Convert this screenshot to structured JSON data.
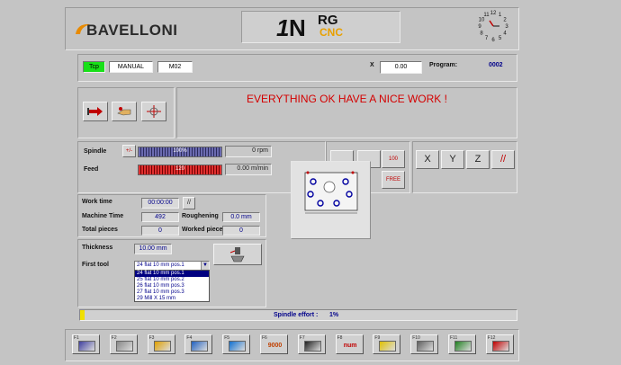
{
  "header": {
    "brand": "BAVELLONI",
    "product_top": "RG",
    "product_bottom": "CNC",
    "product_digit": "1",
    "product_n": "N",
    "clock_numbers": [
      "12",
      "1",
      "2",
      "3",
      "4",
      "5",
      "6",
      "7",
      "8",
      "9",
      "10",
      "11"
    ]
  },
  "mode": {
    "status": "Tcp",
    "mode": "MANUAL",
    "code": "M02"
  },
  "axis": {
    "label": "X",
    "value": "0.00"
  },
  "program": {
    "label": "Program:",
    "value": "0002"
  },
  "message": "EVERYTHING OK HAVE A NICE WORK !",
  "spindle": {
    "label": "Spindle",
    "percent_text": "100%",
    "percent": 1.0,
    "rpm": "0 rpm",
    "toggle": "+/-"
  },
  "feed": {
    "label": "Feed",
    "value_text": "120",
    "percent": 1.0,
    "speed": "0.00 m/min"
  },
  "jog": {
    "buttons": [
      "X",
      "Y",
      "Z",
      "//"
    ],
    "speed_buttons": [
      "100",
      "FREE"
    ]
  },
  "stats": {
    "work_time_label": "Work time",
    "work_time": "00:00:00",
    "machine_time_label": "Machine Time",
    "machine_time": "492",
    "roughening_label": "Roughening",
    "roughening": "0.0 mm",
    "total_pieces_label": "Total pieces",
    "total_pieces": "0",
    "worked_pieces_label": "Worked pieces",
    "worked_pieces": "0",
    "reset_label": "//"
  },
  "tool": {
    "thickness_label": "Thickness",
    "thickness": "10.00 mm",
    "first_tool_label": "First tool",
    "selected": "24 flat 10 mm pos.1",
    "options": [
      "24 flat 10 mm pos.1",
      "25 flat 10 mm pos.2",
      "26 flat 10 mm pos.3",
      "27 flat 10 mm pos.3",
      "29 Mill X 15 mm"
    ]
  },
  "effort": {
    "label": "Spindle effort :",
    "value": "1%",
    "percent": 0.01
  },
  "fkeys": [
    {
      "num": "F1",
      "icon": "camera-icon"
    },
    {
      "num": "F2",
      "icon": "document-icon"
    },
    {
      "num": "F3",
      "icon": "open-folder-icon"
    },
    {
      "num": "F4",
      "icon": "image-icon"
    },
    {
      "num": "F5",
      "icon": "axes-icon"
    },
    {
      "num": "F6",
      "icon": "counter-9000-icon",
      "text": "9000"
    },
    {
      "num": "F7",
      "icon": "monitor-icon"
    },
    {
      "num": "F8",
      "icon": "num-logo-icon",
      "text": "num"
    },
    {
      "num": "F9",
      "icon": "warning-icon"
    },
    {
      "num": "F10",
      "icon": "tool-icon"
    },
    {
      "num": "F11",
      "icon": "grid-icon"
    },
    {
      "num": "F12",
      "icon": "exit-icon"
    }
  ],
  "colors": {
    "message": "#d40000",
    "accent_orange": "#e88a00",
    "value_blue": "#00008a",
    "bar_fill": "#c80000",
    "spindle_bar": "#3a3a8a"
  }
}
